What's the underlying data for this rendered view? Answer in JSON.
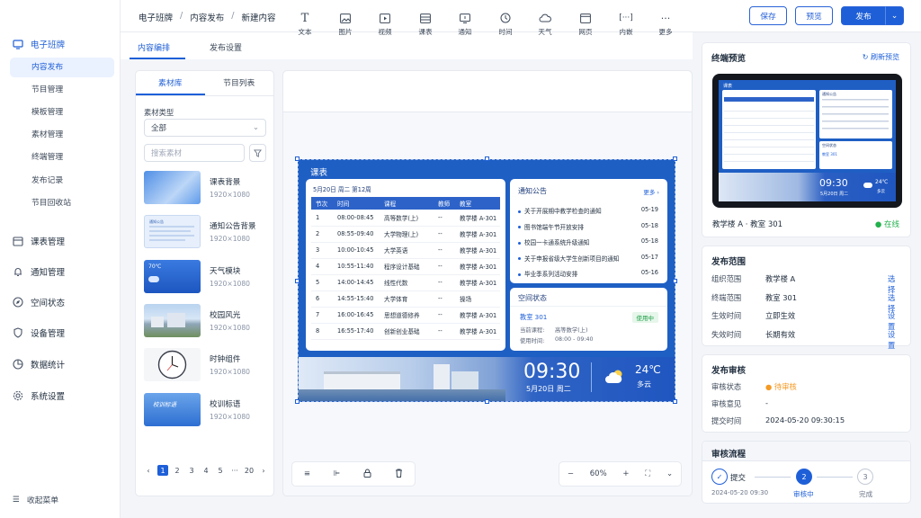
{
  "sidebar": {
    "app_title": "电子班牌",
    "items": [
      "内容发布",
      "节目管理",
      "模板管理",
      "素材管理",
      "终端管理",
      "发布记录",
      "节目回收站"
    ],
    "groups": [
      "课表管理",
      "通知管理",
      "空间状态",
      "设备管理",
      "数据统计",
      "系统设置"
    ],
    "collapse_label": "收起菜单"
  },
  "header": {
    "breadcrumb": [
      "电子班牌",
      "内容发布",
      "新建内容"
    ],
    "save_label": "保存",
    "preview_label": "预览",
    "publish_label": "发布"
  },
  "main": {
    "tabs": [
      "内容编排",
      "发布设置"
    ]
  },
  "library": {
    "tabs": [
      "素材库",
      "节目列表"
    ],
    "type_label": "素材类型",
    "type_value": "全部",
    "search_placeholder": "搜索素材",
    "assets": [
      {
        "name": "课表背景",
        "size": "1920×1080"
      },
      {
        "name": "通知公告背景",
        "size": "1920×1080"
      },
      {
        "name": "天气模块",
        "size": "1920×1080"
      },
      {
        "name": "校园风光",
        "size": "1920×1080"
      },
      {
        "name": "时钟组件",
        "size": "1920×1080"
      },
      {
        "name": "校训标语",
        "size": "1920×1080"
      }
    ],
    "thumb_texts": {
      "notice": "通知公告",
      "weather": "70℃",
      "motto": "校训标语"
    },
    "pages": [
      "1",
      "2",
      "3",
      "4",
      "5",
      "···",
      "20"
    ]
  },
  "toolbar": {
    "tools": [
      "文本",
      "图片",
      "视频",
      "课表",
      "通知",
      "时间",
      "天气",
      "网页",
      "内嵌",
      "更多"
    ]
  },
  "canvas": {
    "title": "课表",
    "date_line": "5月20日 周二 第12周",
    "table_headers": [
      "节次",
      "时间",
      "课程",
      "教师",
      "教室"
    ],
    "rows": [
      [
        "1",
        "08:00-08:45",
        "高等数学(上)",
        "--",
        "教学楼 A-301"
      ],
      [
        "2",
        "08:55-09:40",
        "大学物理(上)",
        "--",
        "教学楼 A-301"
      ],
      [
        "3",
        "10:00-10:45",
        "大学英语",
        "--",
        "教学楼 A-301"
      ],
      [
        "4",
        "10:55-11:40",
        "程序设计基础",
        "--",
        "教学楼 A-301"
      ],
      [
        "5",
        "14:00-14:45",
        "线性代数",
        "--",
        "教学楼 A-301"
      ],
      [
        "6",
        "14:55-15:40",
        "大学体育",
        "--",
        "操场"
      ],
      [
        "7",
        "16:00-16:45",
        "思想道德修养",
        "--",
        "教学楼 A-301"
      ],
      [
        "8",
        "16:55-17:40",
        "创新创业基础",
        "--",
        "教学楼 A-301"
      ]
    ],
    "notice_title": "通知公告",
    "notice_more": "更多 ›",
    "notices": [
      {
        "text": "关于开展期中教学检查的通知",
        "date": "05-19"
      },
      {
        "text": "图书馆端午节开放安排",
        "date": "05-18"
      },
      {
        "text": "校园一卡通系统升级通知",
        "date": "05-18"
      },
      {
        "text": "关于申报省级大学生创新项目的通知",
        "date": "05-17"
      },
      {
        "text": "毕业季系列活动安排",
        "date": "05-16"
      }
    ],
    "space_title": "空间状态",
    "room": "教室 301",
    "room_status": "使用中",
    "current_course_label": "当前课程:",
    "current_course": "高等数学(上)",
    "use_time_label": "使用时间:",
    "use_time": "08:00 - 09:40",
    "time": "09:30",
    "date": "5月20日 周二",
    "temp": "24℃",
    "weather": "多云"
  },
  "zoom": {
    "value": "60%"
  },
  "preview": {
    "title": "终端预览",
    "refresh": "刷新预览",
    "device": "教学楼 A · 教室 301",
    "status": "在线",
    "mini_title": "课表",
    "mini_notice": "通知公告",
    "mini_space": "空间状态",
    "mini_room": "教室 301",
    "mini_time": "09:30",
    "mini_date": "5月20日 周二",
    "mini_temp": "24℃",
    "mini_weather": "多云"
  },
  "scope": {
    "title": "发布范围",
    "rows": [
      {
        "k": "组织范围",
        "v": "教学楼 A",
        "a": "选择"
      },
      {
        "k": "终端范围",
        "v": "教室 301",
        "a": "选择"
      },
      {
        "k": "生效时间",
        "v": "立即生效",
        "a": "设置"
      },
      {
        "k": "失效时间",
        "v": "长期有效",
        "a": "设置"
      }
    ]
  },
  "review": {
    "title": "发布审核",
    "status_label": "审核状态",
    "status_value": "待审核",
    "opinion_label": "审核意见",
    "opinion_value": "-",
    "submit_time_label": "提交时间",
    "submit_time_value": "2024-05-20 09:30:15"
  },
  "flow": {
    "title": "审核流程",
    "steps": [
      {
        "n": "✓",
        "label": "提交",
        "sub": "2024-05-20 09:30"
      },
      {
        "n": "2",
        "label": "审核中",
        "sub": ""
      },
      {
        "n": "3",
        "label": "完成",
        "sub": ""
      }
    ]
  },
  "colors": {
    "primary": "#1e5fd8",
    "canvas_bg": "#1e5fc4",
    "online": "#22b14c",
    "pending": "#f59a23"
  }
}
